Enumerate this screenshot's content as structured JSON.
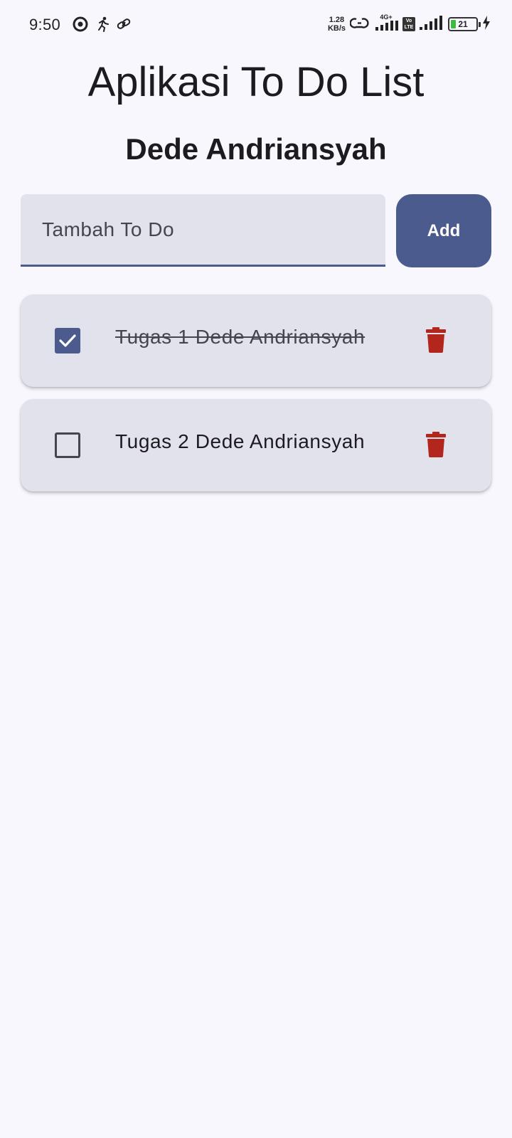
{
  "status_bar": {
    "time": "9:50",
    "speed_value": "1.28",
    "speed_unit": "KB/s",
    "network_type": "4G+",
    "volte_top": "Vo",
    "volte_bottom": "LTE",
    "battery": "21",
    "icons": [
      "location-icon",
      "activity-icon",
      "link-icon",
      "hotspot-icon",
      "signal-icon",
      "signal-icon",
      "battery-icon",
      "charging-icon"
    ]
  },
  "app": {
    "title": "Aplikasi To Do List",
    "subtitle": "Dede Andriansyah"
  },
  "form": {
    "placeholder": "Tambah To Do",
    "value": "",
    "add_label": "Add"
  },
  "todos": [
    {
      "text": "Tugas 1 Dede Andriansyah",
      "done": true
    },
    {
      "text": "Tugas 2 Dede Andriansyah",
      "done": false
    }
  ],
  "colors": {
    "primary": "#4b5b8e",
    "surface": "#e2e2ec",
    "background": "#f8f7fd",
    "delete": "#b3261e"
  }
}
